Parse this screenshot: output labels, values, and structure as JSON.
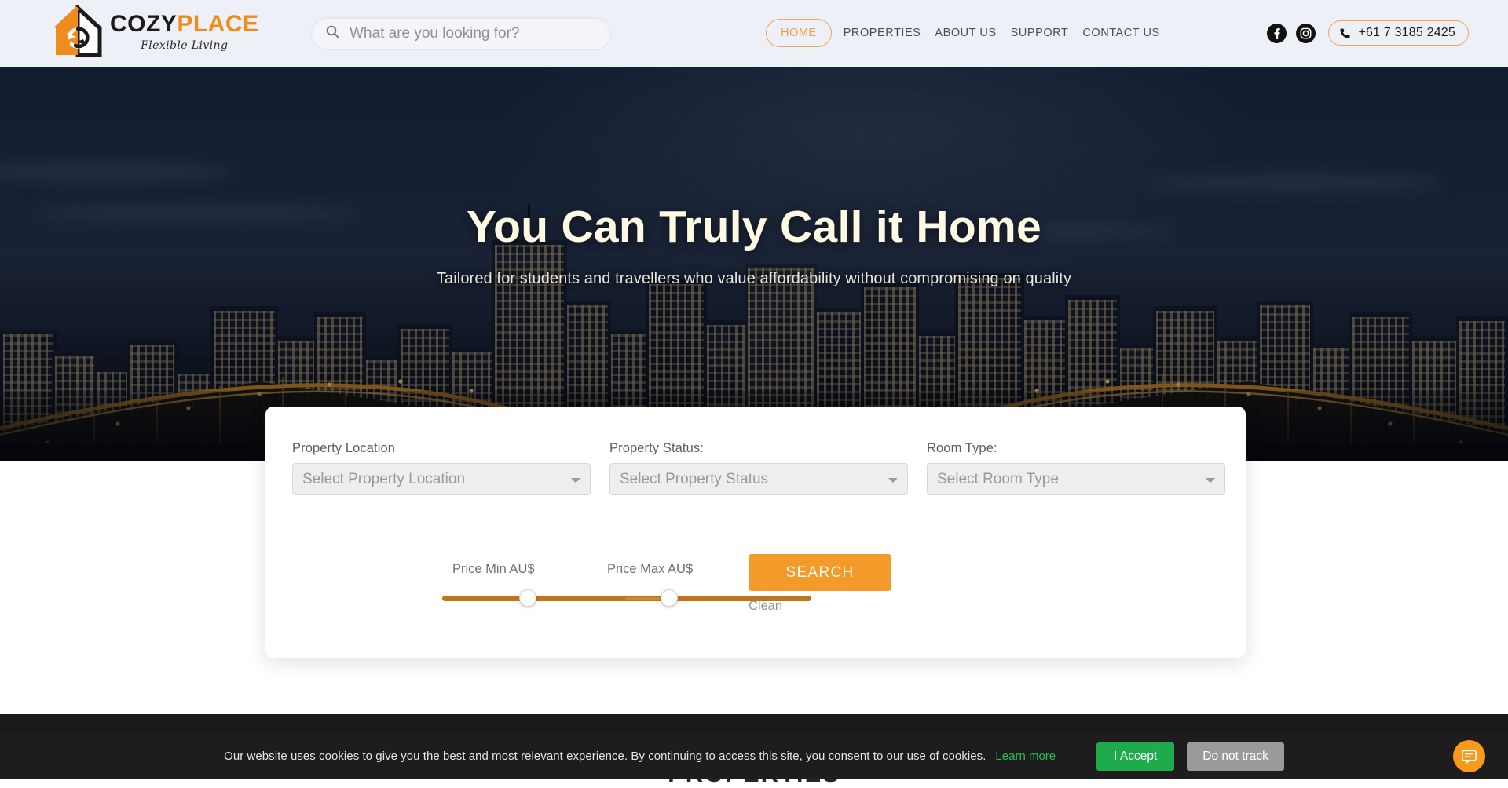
{
  "brand": {
    "name_part1": "COZY",
    "name_part2": "PLACE",
    "tagline": "Flexible Living",
    "accent_color": "#f08b1d"
  },
  "search": {
    "placeholder": "What are you looking for?",
    "value": "",
    "icon": "search-icon"
  },
  "nav": {
    "items": [
      {
        "label": "HOME",
        "active": true
      },
      {
        "label": "PROPERTIES",
        "active": false
      },
      {
        "label": "ABOUT US",
        "active": false
      },
      {
        "label": "SUPPORT",
        "active": false
      },
      {
        "label": "CONTACT US",
        "active": false
      }
    ]
  },
  "header_right": {
    "facebook_icon": "facebook-icon",
    "instagram_icon": "instagram-icon",
    "phone_icon": "phone-icon",
    "phone": "+61 7 3185 2425"
  },
  "hero": {
    "heading": "You Can Truly Call it Home",
    "subheading": "Tailored for students and travellers who value affordability without compromising on quality"
  },
  "search_card": {
    "fields": [
      {
        "label": "Property Location",
        "value": "Select Property Location",
        "name": "property-location-select"
      },
      {
        "label": "Property Status:",
        "value": "Select Property Status",
        "name": "property-status-select"
      },
      {
        "label": "Room Type:",
        "value": "Select Room Type",
        "name": "room-type-select"
      }
    ],
    "price_min_label": "Price Min AU$",
    "price_max_label": "Price Max AU$",
    "search_label": "SEARCH",
    "clean_label": "Clean",
    "accent_color": "#f49a2b",
    "slider_color": "#c1741a"
  },
  "next_section": {
    "heading": "PROPERTIES"
  },
  "cookie": {
    "message": "Our website uses cookies to give you the best and most relevant experience. By continuing to access this site, you consent to our use of cookies.",
    "learn_more": "Learn more",
    "accept": "I Accept",
    "decline": "Do not track",
    "accept_color": "#1eab4b"
  },
  "chat": {
    "icon": "chat-bubble-icon"
  }
}
